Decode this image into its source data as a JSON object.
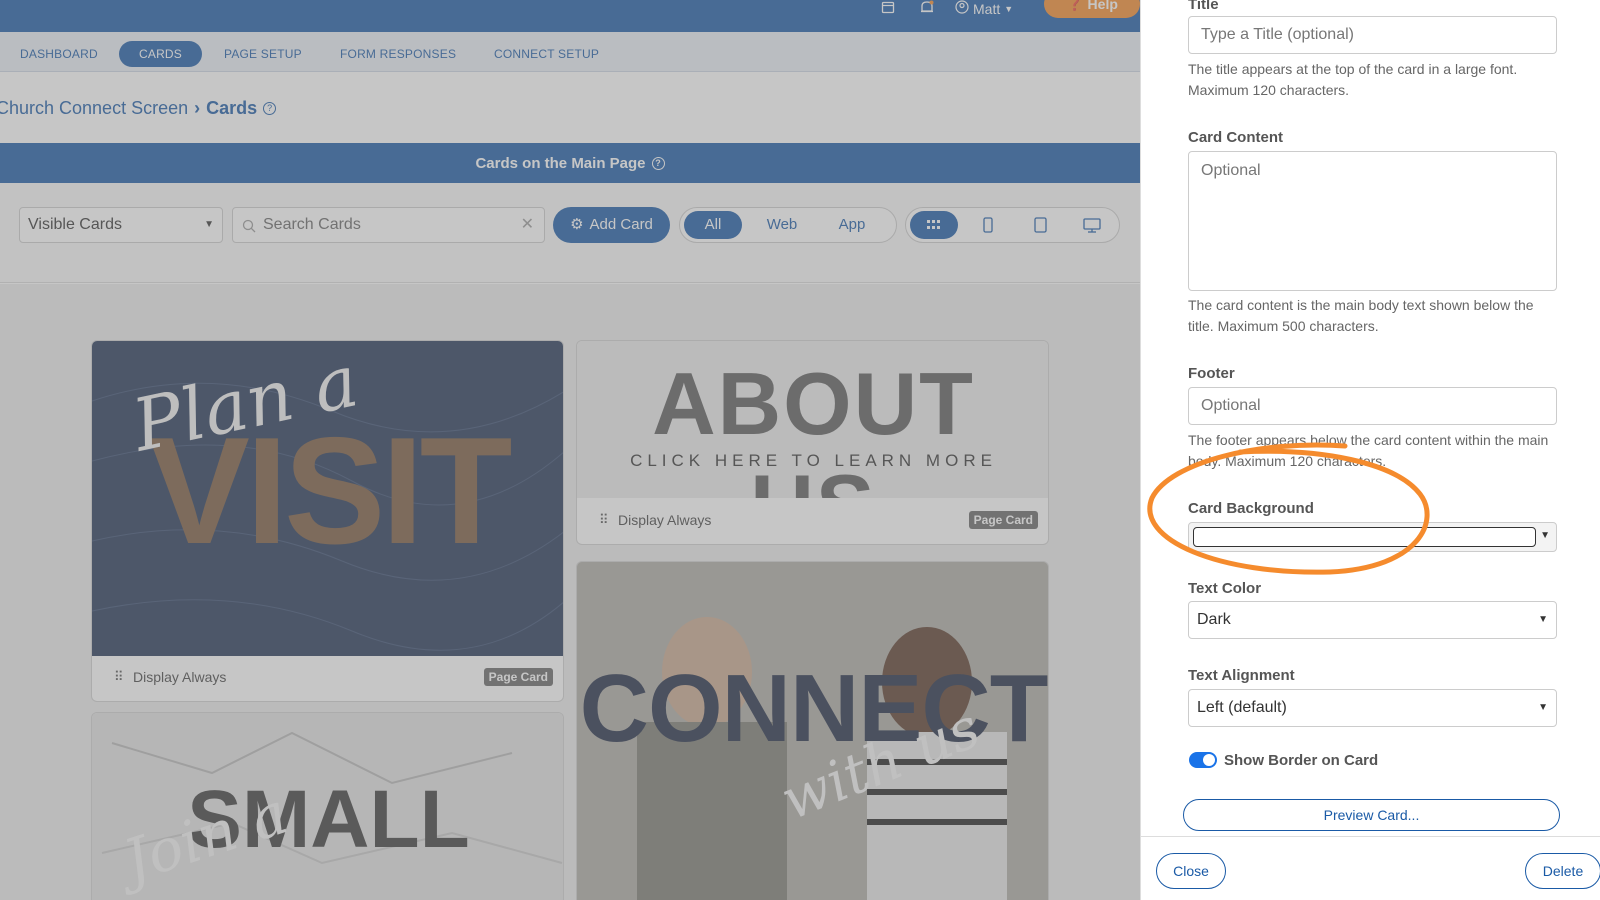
{
  "topbar": {
    "calendar_icon": "calendar-icon",
    "bell_icon": "bell-icon",
    "user_name": "Matt",
    "help_label": "Help"
  },
  "nav": {
    "items": [
      "DASHBOARD",
      "CARDS",
      "PAGE SETUP",
      "FORM RESPONSES",
      "CONNECT SETUP"
    ],
    "active": "CARDS"
  },
  "breadcrumb": {
    "parent": "Church Connect Screen",
    "separator": "›",
    "current": "Cards"
  },
  "section": {
    "title": "Cards on the Main Page"
  },
  "toolbar": {
    "filter_value": "Visible Cards",
    "search_placeholder": "Search Cards",
    "add_card_label": "Add Card",
    "platform_tabs": [
      "All",
      "Web",
      "App"
    ],
    "platform_active": "All",
    "device_icons": [
      "grid-icon",
      "phone-icon",
      "tablet-icon",
      "desktop-icon"
    ],
    "device_active": "grid-icon"
  },
  "cards": [
    {
      "script": "Plan a",
      "headline": "VISIT",
      "footer": "Display Always",
      "badge": "Page Card"
    },
    {
      "headline": "ABOUT US",
      "subline": "CLICK HERE TO LEARN MORE",
      "footer": "Display Always",
      "badge": "Page Card"
    },
    {
      "script": "Join a",
      "headline": "SMALL"
    },
    {
      "headline": "CONNECT",
      "script": "with us"
    }
  ],
  "panel": {
    "title": {
      "label": "Title",
      "placeholder": "Type a Title (optional)",
      "help": "The title appears at the top of the card in a large font. Maximum 120 characters."
    },
    "content": {
      "label": "Card Content",
      "placeholder": "Optional",
      "help": "The card content is the main body text shown below the title. Maximum 500 characters."
    },
    "footer": {
      "label": "Footer",
      "placeholder": "Optional",
      "help": "The footer appears below the card content within the main body. Maximum 120 characters."
    },
    "background": {
      "label": "Card Background",
      "value_color": "#ffffff"
    },
    "text_color": {
      "label": "Text Color",
      "value": "Dark"
    },
    "text_alignment": {
      "label": "Text Alignment",
      "value": "Left (default)"
    },
    "show_border": {
      "label": "Show Border on Card",
      "enabled": true
    },
    "preview_label": "Preview Card...",
    "close_label": "Close",
    "delete_label": "Delete"
  },
  "colors": {
    "brand_blue": "#1a5aa6",
    "help_orange": "#f58b2d",
    "annotation_orange": "#f58b2d",
    "toggle_blue": "#1a73e8"
  }
}
